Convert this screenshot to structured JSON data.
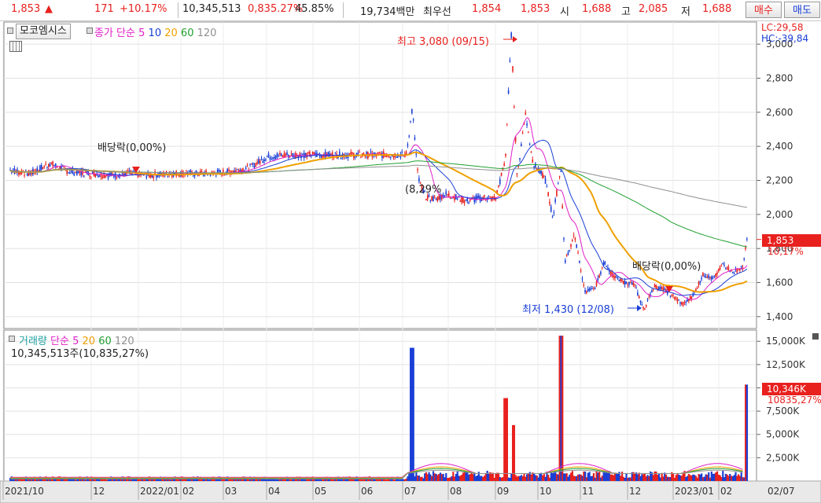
{
  "quote_bar": {
    "price": "1,853",
    "change_arrow": "▲",
    "change": "171",
    "change_pct": "+10.17%",
    "volume": "10,345,513",
    "volume_ratio": "0,835.27%",
    "rate": "45.85%",
    "amount": "19,734백만",
    "best_label": "최우선",
    "best_ask": "1,854",
    "best_bid": "1,853",
    "open_label": "시",
    "open": "1,688",
    "high_label": "고",
    "high": "2,085",
    "low_label": "저",
    "low": "1,688",
    "buy_button": "매수",
    "sell_button": "매도"
  },
  "price_panel": {
    "stock_name": "모코엠시스",
    "ma_label": "종가 단순",
    "ma_periods": [
      "5",
      "10",
      "20",
      "60",
      "120"
    ],
    "ma_colors": [
      "#e020c8",
      "#1a3fd6",
      "#f0a000",
      "#20a030",
      "#909090"
    ],
    "lc_label": "LC:29,58",
    "hc_label": "HC:-39,84",
    "current_label": "1,853",
    "current_pct_label": "10,17%",
    "annotations": {
      "high": "최고 3,080 (09/15)",
      "low": "최저 1,430 (12/08)",
      "dividend1": "배당락(0,00%)",
      "dividend2": "배당락(0,00%)",
      "gap": "(8,29%"
    }
  },
  "volume_panel": {
    "title": "거래량",
    "ma_label": "단순",
    "ma_periods": [
      "5",
      "20",
      "60",
      "120"
    ],
    "ma_colors": [
      "#e020c8",
      "#f0a000",
      "#20a030",
      "#909090"
    ],
    "volume_info": "10,345,513주(10,835,27%)",
    "current_label": "10,346K",
    "current_pct_label": "10835,27%"
  },
  "chart_data": {
    "type": "candlestick",
    "price_axis": {
      "ticks": [
        "1,400",
        "1,600",
        "1,800",
        "2,000",
        "2,200",
        "2,400",
        "2,600",
        "2,800",
        "3,000"
      ],
      "tick_values": [
        1400,
        1600,
        1800,
        2000,
        2200,
        2400,
        2600,
        2800,
        3000
      ],
      "range": [
        1330,
        3130
      ]
    },
    "volume_axis": {
      "ticks": [
        "2,500K",
        "5,000K",
        "7,500K",
        "10,000K",
        "12,500K",
        "15,000K"
      ],
      "tick_values": [
        2500,
        5000,
        7500,
        10000,
        12500,
        15000
      ],
      "range": [
        0,
        16200
      ]
    },
    "x_axis_labels": [
      "2021/10",
      "12",
      "2022/01",
      "02",
      "03",
      "04",
      "05",
      "06",
      "07",
      "08",
      "09",
      "10",
      "11",
      "12",
      "2023/01",
      "02",
      "02/07"
    ],
    "price_path": [
      [
        0,
        2260
      ],
      [
        1,
        2240
      ],
      [
        2,
        2300
      ],
      [
        3,
        2250
      ],
      [
        4,
        2240
      ],
      [
        5,
        2230
      ],
      [
        6,
        2240
      ],
      [
        7,
        2230
      ],
      [
        8,
        2240
      ],
      [
        9,
        2240
      ],
      [
        10,
        2240
      ],
      [
        11,
        2250
      ],
      [
        12,
        2270
      ],
      [
        13,
        2340
      ],
      [
        14,
        2350
      ],
      [
        15,
        2350
      ],
      [
        16,
        2350
      ],
      [
        17,
        2350
      ],
      [
        18,
        2350
      ],
      [
        19,
        2350
      ],
      [
        20,
        2350
      ],
      [
        20.3,
        2620
      ],
      [
        20.6,
        2210
      ],
      [
        21,
        2100
      ],
      [
        21.5,
        2090
      ],
      [
        22,
        2120
      ],
      [
        23,
        2080
      ],
      [
        24,
        2100
      ],
      [
        24.5,
        2090
      ],
      [
        25,
        2320
      ],
      [
        25.3,
        3060
      ],
      [
        25.6,
        2210
      ],
      [
        26,
        2600
      ],
      [
        26.4,
        2300
      ],
      [
        27,
        2210
      ],
      [
        27.4,
        1980
      ],
      [
        27.8,
        2280
      ],
      [
        28,
        1720
      ],
      [
        28.5,
        1880
      ],
      [
        29,
        1550
      ],
      [
        29.5,
        1560
      ],
      [
        30,
        1720
      ],
      [
        30.5,
        1630
      ],
      [
        31,
        1600
      ],
      [
        31.5,
        1590
      ],
      [
        32,
        1440
      ],
      [
        32.5,
        1580
      ],
      [
        33,
        1560
      ],
      [
        34,
        1470
      ],
      [
        34.5,
        1530
      ],
      [
        35,
        1650
      ],
      [
        35.5,
        1620
      ],
      [
        36,
        1710
      ],
      [
        36.5,
        1660
      ],
      [
        37,
        1690
      ],
      [
        37.2,
        1853
      ]
    ],
    "volume_spikes": [
      [
        20.3,
        14300
      ],
      [
        25,
        8900
      ],
      [
        25.4,
        6000
      ],
      [
        27.8,
        15600
      ],
      [
        37.2,
        10346
      ]
    ]
  }
}
